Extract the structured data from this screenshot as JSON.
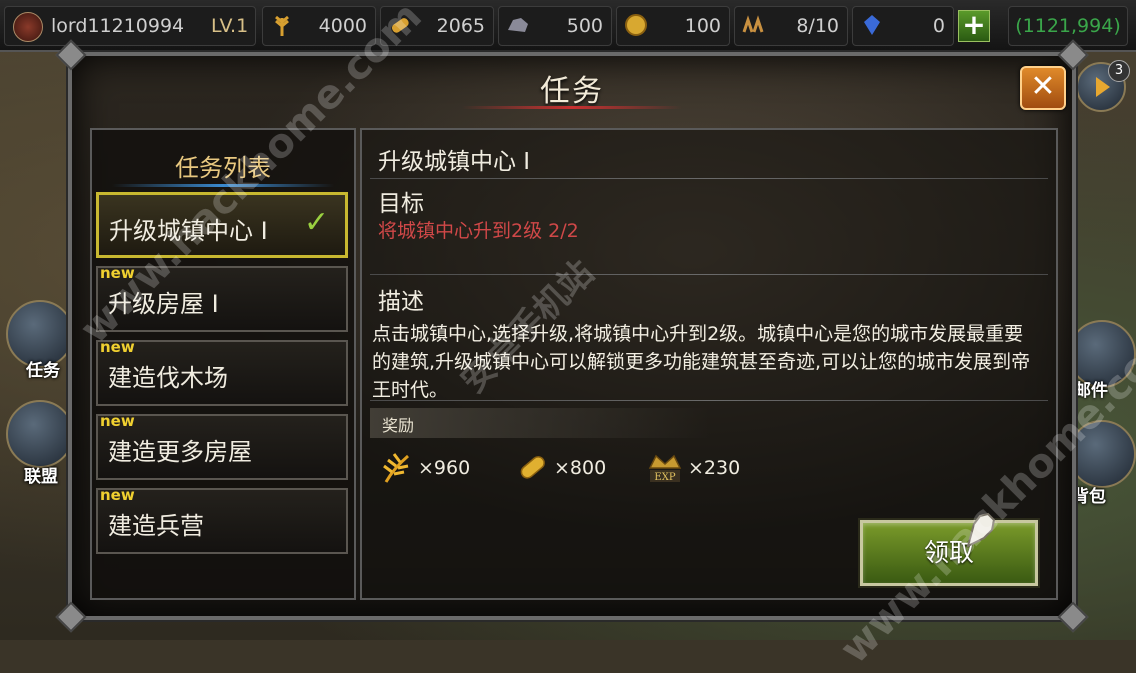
{
  "topbar": {
    "player_name": "lord11210994",
    "level": "LV.1",
    "resources": [
      {
        "icon": "wheat-icon",
        "value": "4000"
      },
      {
        "icon": "wood-log-icon",
        "value": "2065"
      },
      {
        "icon": "stone-icon",
        "value": "500"
      },
      {
        "icon": "gold-coin-icon",
        "value": "100"
      },
      {
        "icon": "army-icon",
        "value": "8/10"
      },
      {
        "icon": "gem-icon",
        "value": "0"
      }
    ],
    "gems_total": "(1121,994)"
  },
  "side": {
    "left_quest_label": "任务",
    "left_alliance_label": "联盟",
    "right_mail_label": "邮件",
    "right_bag_label": "背包",
    "badge_count": "3"
  },
  "modal": {
    "title": "任务",
    "close_label": "✕",
    "list_title": "任务列表",
    "quests": [
      {
        "label": "升级城镇中心 Ⅰ",
        "new": "",
        "completed": "✓"
      },
      {
        "label": "升级房屋 Ⅰ",
        "new": "new",
        "completed": ""
      },
      {
        "label": "建造伐木场",
        "new": "new",
        "completed": ""
      },
      {
        "label": "建造更多房屋",
        "new": "new",
        "completed": ""
      },
      {
        "label": "建造兵营",
        "new": "new",
        "completed": ""
      }
    ],
    "detail": {
      "title": "升级城镇中心 Ⅰ",
      "goal_heading": "目标",
      "goal_text": "将城镇中心升到2级   2/2",
      "desc_heading": "描述",
      "desc_text": "点击城镇中心,选择升级,将城镇中心升到2级。城镇中心是您的城市发展最重要的建筑,升级城镇中心可以解锁更多功能建筑甚至奇迹,可以让您的城市发展到帝王时代。",
      "reward_heading": "奖励",
      "rewards": [
        {
          "icon": "wheat-icon",
          "amount": "×960"
        },
        {
          "icon": "wood-log-icon",
          "amount": "×800"
        },
        {
          "icon": "exp-icon",
          "amount": "×230",
          "icon_text": "EXP"
        }
      ],
      "claim_label": "领取"
    }
  },
  "watermark": {
    "text1": "www.hackhome.com",
    "text2": "www.hackhome.com",
    "text3": "安卓手机站"
  }
}
